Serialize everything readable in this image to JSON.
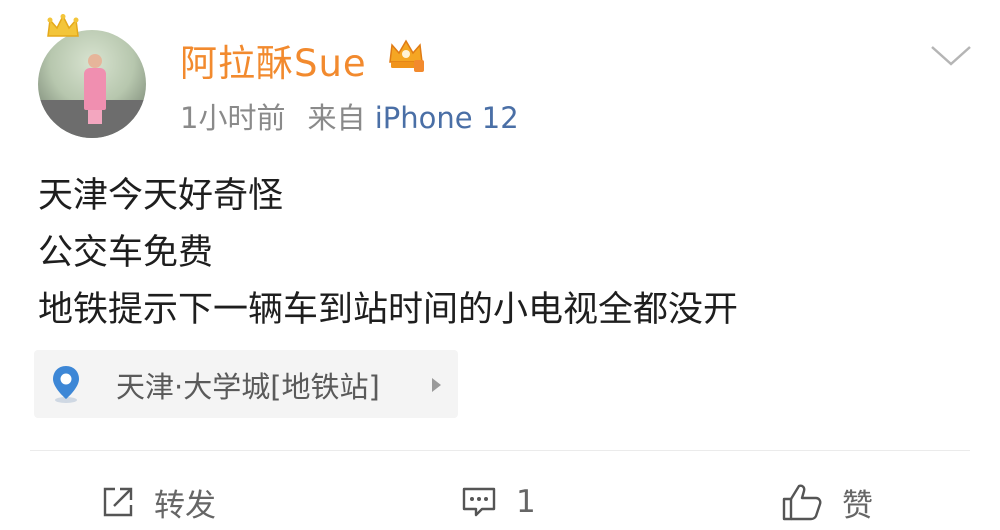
{
  "post": {
    "username": "阿拉酥Sue",
    "time": "1小时前",
    "source_prefix": "来自",
    "device": "iPhone 12",
    "lines": [
      "天津今天好奇怪",
      "公交车免费",
      "地铁提示下一辆车到站时间的小电视全都没开"
    ],
    "location": "天津·大学城[地铁站]"
  },
  "actions": {
    "repost_label": "转发",
    "comment_count": "1",
    "like_label": "赞"
  },
  "colors": {
    "username": "#f28a2e",
    "device_link": "#4a6fa6",
    "location_pin": "#3d87d6",
    "meta_gray": "#8a8a8a"
  },
  "icons": {
    "crown": "crown-icon",
    "vip": "vip-crown-icon",
    "chevron": "chevron-down-icon",
    "pin": "location-pin-icon",
    "repost": "repost-icon",
    "comment": "comment-icon",
    "like": "thumbs-up-icon"
  }
}
